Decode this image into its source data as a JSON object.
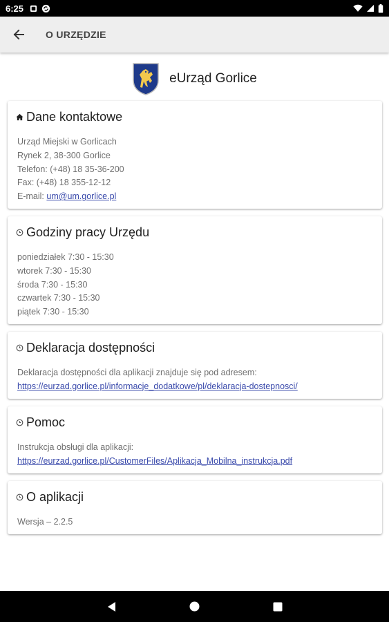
{
  "status_bar": {
    "time": "6:25"
  },
  "app_bar": {
    "title": "O URZĘDZIE"
  },
  "brand": {
    "name": "eUrząd Gorlice"
  },
  "cards": [
    {
      "title": "Dane kontaktowe",
      "lines": [
        "Urząd Miejski w Gorlicach",
        "Rynek 2, 38-300 Gorlice",
        "Telefon: (+48) 18 35-36-200",
        "Fax: (+48) 18 355-12-12"
      ],
      "email_label": "E-mail:",
      "email": "um@um.gorlice.pl"
    },
    {
      "title": "Godziny pracy Urzędu",
      "lines": [
        "poniedziałek 7:30 - 15:30",
        "wtorek 7:30 - 15:30",
        "środa 7:30 - 15:30",
        "czwartek 7:30 - 15:30",
        "piątek 7:30 - 15:30"
      ]
    },
    {
      "title": "Deklaracja dostępności",
      "text": "Deklaracja dostępności dla aplikacji znajduje się pod adresem:",
      "link": "https://eurzad.gorlice.pl/informacje_dodatkowe/pl/deklaracja-dostepnosci/"
    },
    {
      "title": "Pomoc",
      "text": "Instrukcja obsługi dla aplikacji:",
      "link": "https://eurzad.gorlice.pl/CustomerFiles/Aplikacja_Mobilna_instrukcja.pdf"
    },
    {
      "title": "O aplikacji",
      "text": "Wersja – 2.2.5"
    }
  ],
  "icons": {
    "back": "arrow-left-icon",
    "contact": "home-icon",
    "hours": "clock-icon",
    "declaration": "clock-icon",
    "help": "clock-icon",
    "about": "clock-icon"
  },
  "colors": {
    "link": "#3949ab",
    "app_bar": "#eeeeee",
    "logo_blue": "#1e3a8a",
    "logo_gold": "#f2c94c"
  }
}
